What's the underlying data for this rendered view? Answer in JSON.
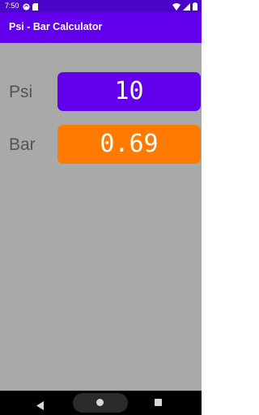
{
  "status_bar": {
    "time": "7:50",
    "left_icons": [
      "sync-icon",
      "sd-card-icon"
    ],
    "right_icons": [
      "wifi-icon",
      "cellular-signal-icon",
      "battery-icon"
    ]
  },
  "app_bar": {
    "title": "Psi - Bar Calculator",
    "color": "#6200ee"
  },
  "psi_row": {
    "label": "Psi",
    "value": "10",
    "box_color": "#6200ee"
  },
  "bar_row": {
    "label": "Bar",
    "value": "0.69",
    "box_color": "#ff7b00"
  },
  "background_color": "#a9a9a9",
  "nav_bar": {
    "buttons": [
      "back-icon",
      "home-icon",
      "recents-icon"
    ]
  }
}
